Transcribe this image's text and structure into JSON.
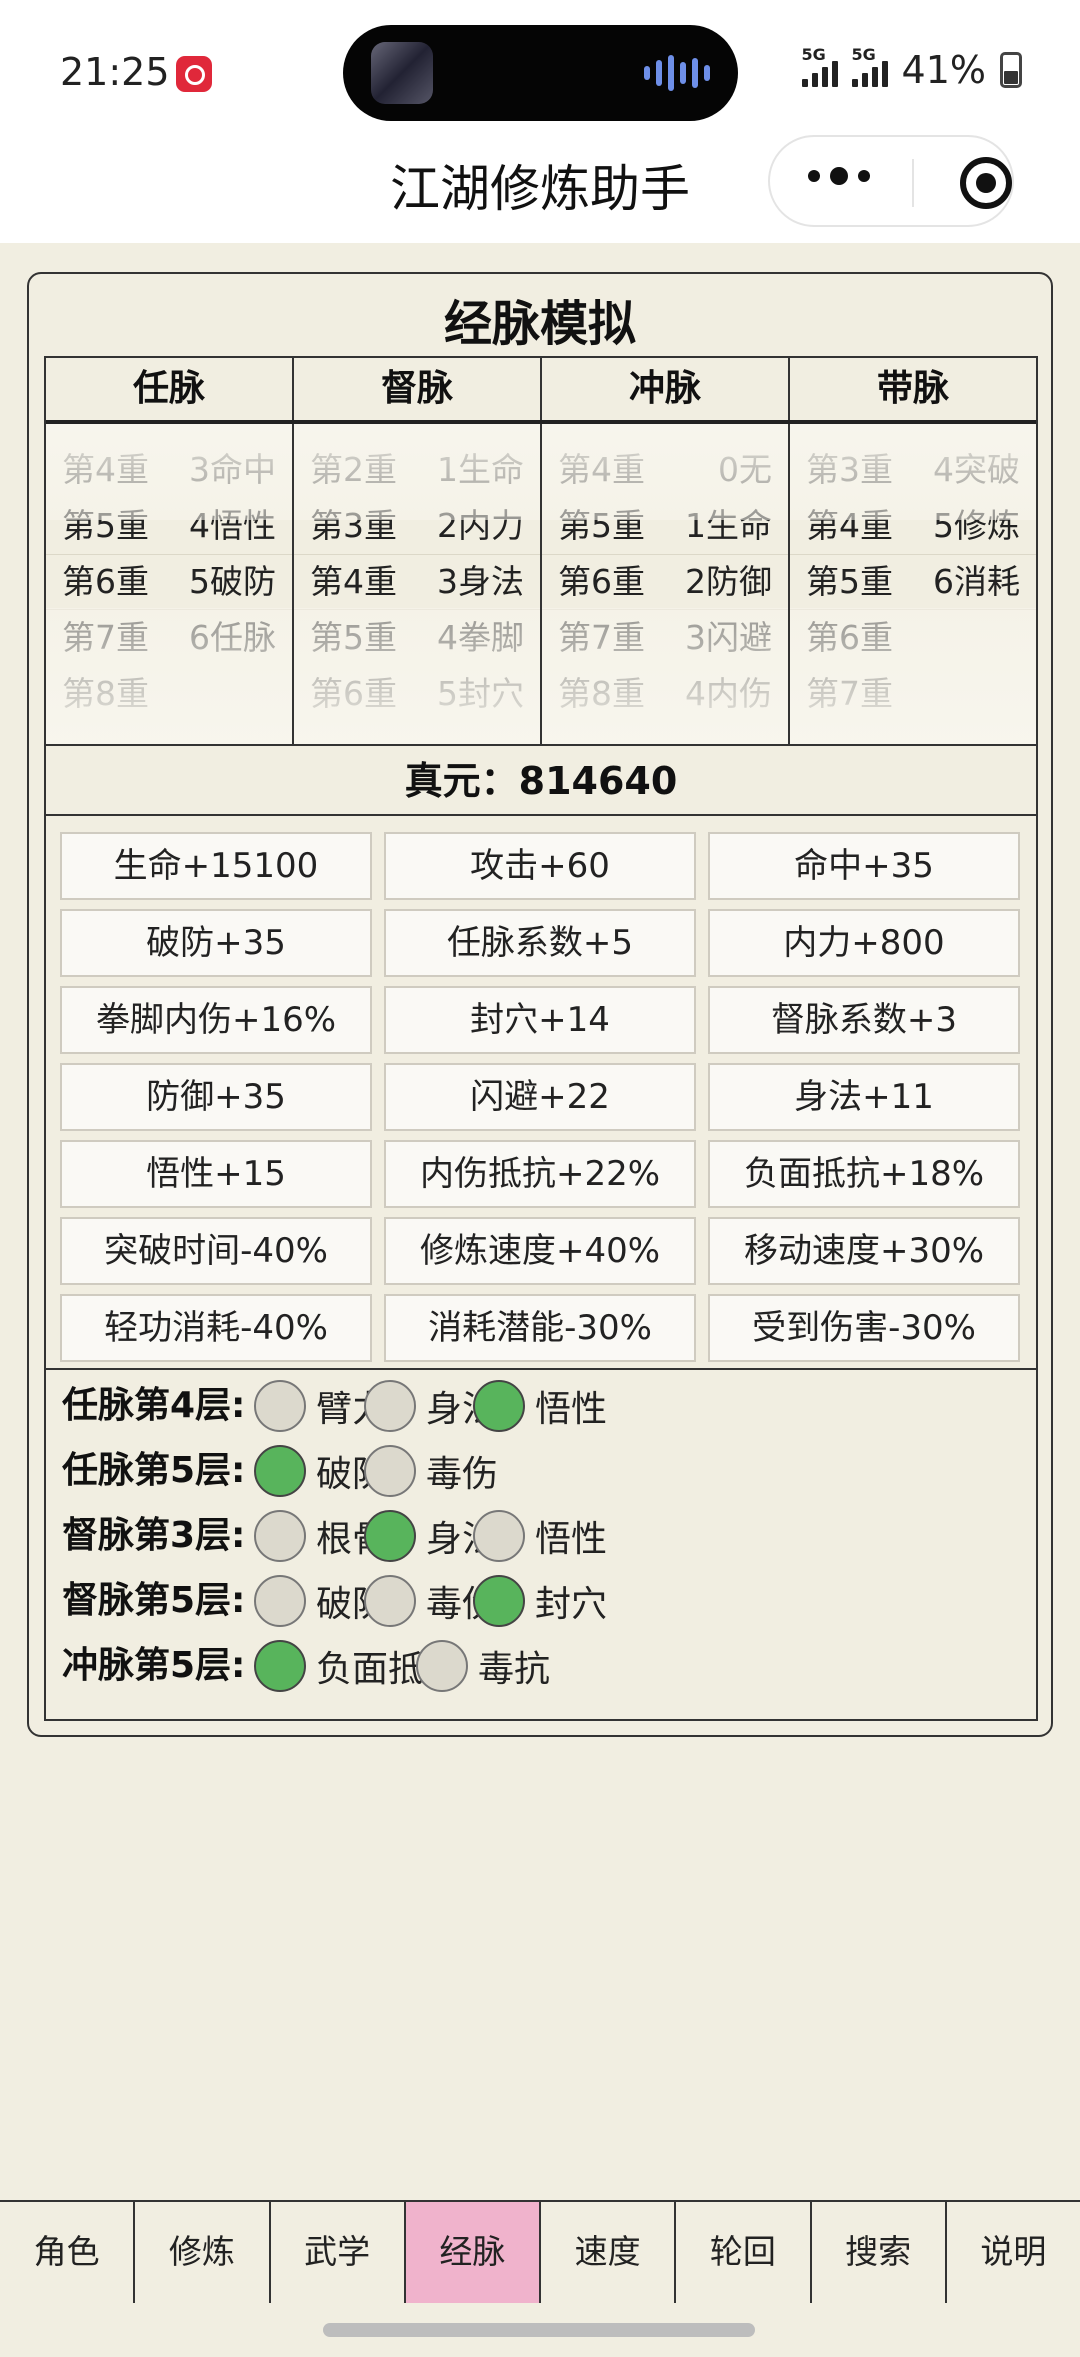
{
  "status": {
    "time": "21:25",
    "sig1": "5G",
    "sig2": "5G",
    "battery": "41%"
  },
  "app": {
    "title": "江湖修炼助手"
  },
  "card": {
    "title": "经脉模拟"
  },
  "columns": [
    {
      "name": "任脉",
      "rows": [
        [
          "第4重",
          "3命中"
        ],
        [
          "第5重",
          "4悟性"
        ],
        [
          "第6重",
          "5破防"
        ],
        [
          "第7重",
          "6任脉"
        ],
        [
          "第8重",
          ""
        ]
      ]
    },
    {
      "name": "督脉",
      "rows": [
        [
          "第2重",
          "1生命"
        ],
        [
          "第3重",
          "2内力"
        ],
        [
          "第4重",
          "3身法"
        ],
        [
          "第5重",
          "4拳脚"
        ],
        [
          "第6重",
          "5封穴"
        ]
      ]
    },
    {
      "name": "冲脉",
      "rows": [
        [
          "第4重",
          "0无"
        ],
        [
          "第5重",
          "1生命"
        ],
        [
          "第6重",
          "2防御"
        ],
        [
          "第7重",
          "3闪避"
        ],
        [
          "第8重",
          "4内伤"
        ]
      ]
    },
    {
      "name": "带脉",
      "rows": [
        [
          "第3重",
          "4突破"
        ],
        [
          "第4重",
          "5修炼"
        ],
        [
          "第5重",
          "6消耗"
        ],
        [
          "第6重",
          ""
        ],
        [
          "第7重",
          ""
        ]
      ]
    }
  ],
  "zhenyuan": {
    "label": "真元：",
    "value": "814640"
  },
  "attributes": [
    "生命+15100",
    "攻击+60",
    "命中+35",
    "破防+35",
    "任脉系数+5",
    "内力+800",
    "拳脚内伤+16%",
    "封穴+14",
    "督脉系数+3",
    "防御+35",
    "闪避+22",
    "身法+11",
    "悟性+15",
    "内伤抵抗+22%",
    "负面抵抗+18%",
    "突破时间-40%",
    "修炼速度+40%",
    "移动速度+30%",
    "轻功消耗-40%",
    "消耗潜能-30%",
    "受到伤害-30%"
  ],
  "options": [
    {
      "label": "任脉第4层:",
      "choices": [
        {
          "text": "臂力",
          "on": false
        },
        {
          "text": "身法",
          "on": false
        },
        {
          "text": "悟性",
          "on": true
        }
      ]
    },
    {
      "label": "任脉第5层:",
      "choices": [
        {
          "text": "破防",
          "on": true
        },
        {
          "text": "毒伤",
          "on": false
        }
      ]
    },
    {
      "label": "督脉第3层:",
      "choices": [
        {
          "text": "根骨",
          "on": false
        },
        {
          "text": "身法",
          "on": true
        },
        {
          "text": "悟性",
          "on": false
        }
      ]
    },
    {
      "label": "督脉第5层:",
      "choices": [
        {
          "text": "破防",
          "on": false
        },
        {
          "text": "毒伤",
          "on": false
        },
        {
          "text": "封穴",
          "on": true
        }
      ]
    },
    {
      "label": "冲脉第5层:",
      "choices": [
        {
          "text": "负面抵抗",
          "on": true
        },
        {
          "text": "毒抗",
          "on": false
        }
      ]
    }
  ],
  "nav": [
    "角色",
    "修炼",
    "武学",
    "经脉",
    "速度",
    "轮回",
    "搜索",
    "说明"
  ],
  "nav_active": "经脉"
}
